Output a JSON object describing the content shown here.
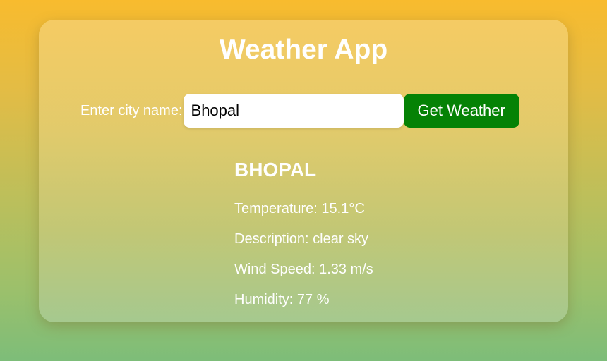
{
  "app": {
    "title": "Weather App"
  },
  "form": {
    "label": "Enter city name:",
    "input_value": "Bhopal",
    "button_label": "Get Weather"
  },
  "result": {
    "city": "BHOPAL",
    "temperature": "Temperature: 15.1°C",
    "description": "Description: clear sky",
    "wind_speed": "Wind Speed: 1.33 m/s",
    "humidity": "Humidity: 77 %"
  },
  "colors": {
    "button": "#058205",
    "text": "#ffffff",
    "input_bg": "#ffffff"
  }
}
